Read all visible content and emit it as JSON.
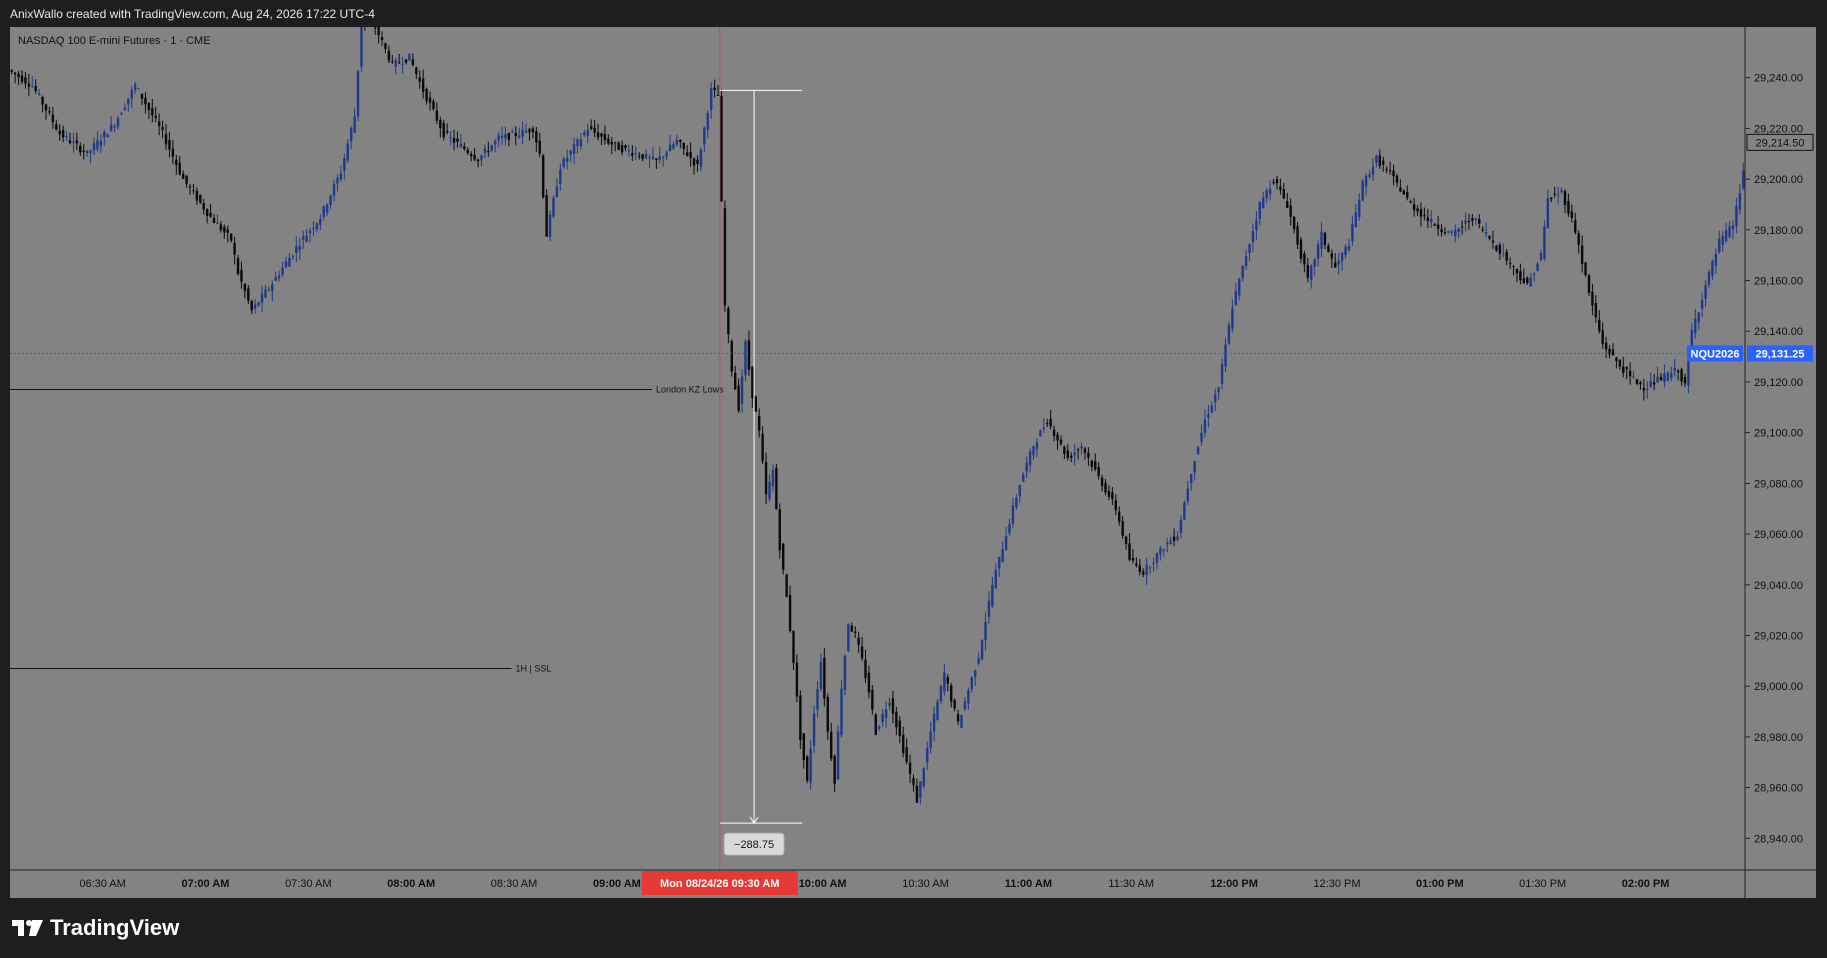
{
  "header": {
    "text": "AnixWallo created with TradingView.com, Aug 24, 2026 17:22 UTC-4"
  },
  "footer": {
    "brand": "TradingView",
    "logo_icon": "tradingview-logo-icon"
  },
  "colors": {
    "plot_bg": "#838383",
    "outer_bg": "#1e1e1e",
    "candle_up": "#1e3a8a",
    "candle_down": "#0a0a0a",
    "session_line": "#e53935",
    "session_label_bg": "#e53935",
    "price_line": "#2962ff",
    "price_label_bg": "#2962ff"
  },
  "chart_data": {
    "type": "candlestick",
    "symbol_title": "NASDAQ 100 E-mini Futures · 1 · CME",
    "y_axis": {
      "ylim": [
        28927.5,
        29260
      ],
      "ticks": [
        29240,
        29220,
        29200,
        29180,
        29160,
        29140,
        29120,
        29100,
        29080,
        29060,
        29040,
        29020,
        29000,
        28980,
        28960,
        28940
      ],
      "tick_labels": [
        "29,240.00",
        "29,220.00",
        "29,200.00",
        "29,180.00",
        "29,160.00",
        "29,140.00",
        "29,120.00",
        "29,100.00",
        "29,080.00",
        "29,060.00",
        "29,040.00",
        "29,020.00",
        "29,000.00",
        "28,980.00",
        "28,960.00",
        "28,940.00"
      ]
    },
    "x_axis": {
      "tick_labels": [
        "06:30 AM",
        "07:00 AM",
        "07:30 AM",
        "08:00 AM",
        "08:30 AM",
        "09:00 AM",
        "10:00 AM",
        "10:30 AM",
        "11:00 AM",
        "11:30 AM",
        "12:00 PM",
        "12:30 PM",
        "01:00 PM",
        "01:30 PM",
        "02:00 PM"
      ],
      "bold_labels": [
        "07:00 AM",
        "08:00 AM",
        "09:00 AM",
        "10:00 AM",
        "11:00 AM",
        "12:00 PM",
        "01:00 PM",
        "02:00 PM"
      ],
      "minutes": [
        390,
        420,
        450,
        480,
        510,
        540,
        600,
        630,
        660,
        690,
        720,
        750,
        780,
        810,
        840
      ],
      "xlim_minutes": [
        363,
        869
      ],
      "session_marker": {
        "minute": 570,
        "label": "Mon 08/24/26   09:30 AM"
      }
    },
    "price_path": [
      [
        363,
        29243
      ],
      [
        370,
        29237
      ],
      [
        378,
        29218
      ],
      [
        386,
        29210
      ],
      [
        394,
        29222
      ],
      [
        400,
        29237
      ],
      [
        408,
        29218
      ],
      [
        414,
        29200
      ],
      [
        422,
        29185
      ],
      [
        428,
        29176
      ],
      [
        430,
        29163
      ],
      [
        434,
        29148
      ],
      [
        440,
        29159
      ],
      [
        448,
        29175
      ],
      [
        454,
        29185
      ],
      [
        460,
        29203
      ],
      [
        464,
        29225
      ],
      [
        466,
        29262
      ],
      [
        470,
        29260
      ],
      [
        475,
        29245
      ],
      [
        480,
        29248
      ],
      [
        484,
        29235
      ],
      [
        490,
        29218
      ],
      [
        496,
        29212
      ],
      [
        500,
        29208
      ],
      [
        506,
        29216
      ],
      [
        512,
        29218
      ],
      [
        516,
        29220
      ],
      [
        518,
        29210
      ],
      [
        520,
        29178
      ],
      [
        524,
        29205
      ],
      [
        532,
        29220
      ],
      [
        540,
        29213
      ],
      [
        546,
        29210
      ],
      [
        552,
        29207
      ],
      [
        558,
        29215
      ],
      [
        564,
        29205
      ],
      [
        568,
        29235
      ],
      [
        570,
        29233
      ],
      [
        571,
        29190
      ],
      [
        572,
        29150
      ],
      [
        574,
        29125
      ],
      [
        576,
        29110
      ],
      [
        578,
        29135
      ],
      [
        580,
        29115
      ],
      [
        582,
        29100
      ],
      [
        584,
        29075
      ],
      [
        586,
        29085
      ],
      [
        588,
        29055
      ],
      [
        590,
        29035
      ],
      [
        592,
        29010
      ],
      [
        594,
        28980
      ],
      [
        596,
        28962
      ],
      [
        598,
        28990
      ],
      [
        600,
        29010
      ],
      [
        602,
        28982
      ],
      [
        604,
        28963
      ],
      [
        606,
        29000
      ],
      [
        608,
        29025
      ],
      [
        610,
        29020
      ],
      [
        612,
        29010
      ],
      [
        614,
        28998
      ],
      [
        616,
        28982
      ],
      [
        620,
        28995
      ],
      [
        624,
        28975
      ],
      [
        628,
        28955
      ],
      [
        632,
        28982
      ],
      [
        636,
        29005
      ],
      [
        640,
        28985
      ],
      [
        646,
        29012
      ],
      [
        650,
        29040
      ],
      [
        654,
        29060
      ],
      [
        658,
        29080
      ],
      [
        662,
        29095
      ],
      [
        666,
        29105
      ],
      [
        672,
        29090
      ],
      [
        676,
        29095
      ],
      [
        680,
        29085
      ],
      [
        686,
        29070
      ],
      [
        690,
        29050
      ],
      [
        694,
        29045
      ],
      [
        700,
        29055
      ],
      [
        704,
        29060
      ],
      [
        708,
        29085
      ],
      [
        712,
        29105
      ],
      [
        716,
        29118
      ],
      [
        720,
        29150
      ],
      [
        724,
        29170
      ],
      [
        728,
        29190
      ],
      [
        732,
        29200
      ],
      [
        736,
        29190
      ],
      [
        740,
        29170
      ],
      [
        742,
        29160
      ],
      [
        746,
        29178
      ],
      [
        750,
        29165
      ],
      [
        754,
        29175
      ],
      [
        758,
        29198
      ],
      [
        762,
        29208
      ],
      [
        766,
        29202
      ],
      [
        772,
        29190
      ],
      [
        778,
        29183
      ],
      [
        784,
        29178
      ],
      [
        790,
        29185
      ],
      [
        796,
        29175
      ],
      [
        802,
        29165
      ],
      [
        806,
        29158
      ],
      [
        810,
        29170
      ],
      [
        812,
        29192
      ],
      [
        816,
        29195
      ],
      [
        820,
        29180
      ],
      [
        824,
        29155
      ],
      [
        828,
        29135
      ],
      [
        832,
        29128
      ],
      [
        836,
        29122
      ],
      [
        840,
        29118
      ],
      [
        846,
        29122
      ],
      [
        850,
        29125
      ],
      [
        852,
        29118
      ],
      [
        854,
        29140
      ],
      [
        858,
        29158
      ],
      [
        862,
        29175
      ],
      [
        866,
        29182
      ],
      [
        868,
        29195
      ],
      [
        870,
        29212
      ],
      [
        871,
        29215
      ]
    ],
    "candle_interval_minutes": 1,
    "last_price": {
      "value": 29131.25,
      "symbol": "NQU2026",
      "label": "29,131.25"
    },
    "top_price_label": {
      "value": 29214.5,
      "label": "29,214.50"
    },
    "horizontal_lines": [
      {
        "label": "London KZ Lows",
        "value": 29117,
        "end_minute": 573
      },
      {
        "label": "1H | SSL",
        "value": 29007,
        "end_minute": 532
      }
    ],
    "measure": {
      "from_value": 29235,
      "to_value": 28946,
      "start_minute": 570,
      "end_minute": 594,
      "label": "−288.75"
    }
  }
}
